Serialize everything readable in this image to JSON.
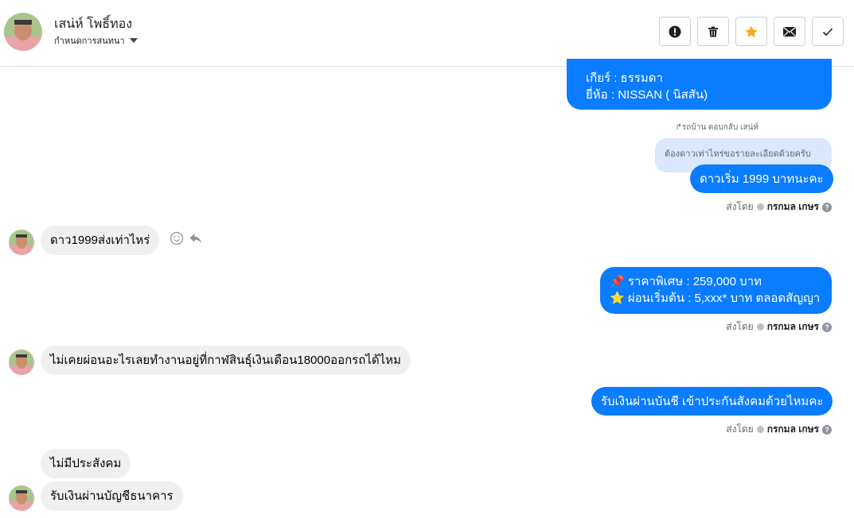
{
  "header": {
    "name": "เสน่ห์ โพธิ์ทอง",
    "status": "กำหนดการสนทนา"
  },
  "messages": {
    "m1_line1": "เกียร์ : ธรรมดา",
    "m1_line2": "ยี่ห้อ : NISSAN ( นิสสัน)",
    "reply_label": "รถบ้าน ตอบกลับ เสน่ห์",
    "quoted": "ต้องดาวเท่าไหร่ขอรายละเอียดด้วยครับ",
    "m2": "ดาวเริ่ม 1999 บาทนะคะ",
    "in1": "ดาว1999ส่งเท่าไหร่",
    "m3_line1": "📌 ราคาพิเศษ : 259,000 บาท",
    "m3_line2": "⭐ ผ่อนเริ่มต้น : 5,xxx* บาท ตลอดสัญญา",
    "in2": "ไม่เคยผ่อนอะไรเลยทำงานอยู่ที่กาฬสินธุ์เงินเดือน18000ออกรถได้ไหม",
    "m4": "รับเงินผ่านบันชี เข้าประกันสังคมด้วยไหมคะ",
    "in3": "ไม่มีประสังคม",
    "in4": "รับเงินผ่านบัญชีธนาคาร"
  },
  "sender": {
    "sent_by": "ส่งโดย",
    "name": "กรกมล เกษร"
  },
  "icons": [
    "alert-icon",
    "trash-icon",
    "star-icon",
    "mail-icon",
    "check-icon",
    "smiley-icon",
    "reply-icon"
  ],
  "colors": {
    "outgoing": "#0a7cff",
    "incoming": "#f0f0f0",
    "star": "#f5a623"
  }
}
